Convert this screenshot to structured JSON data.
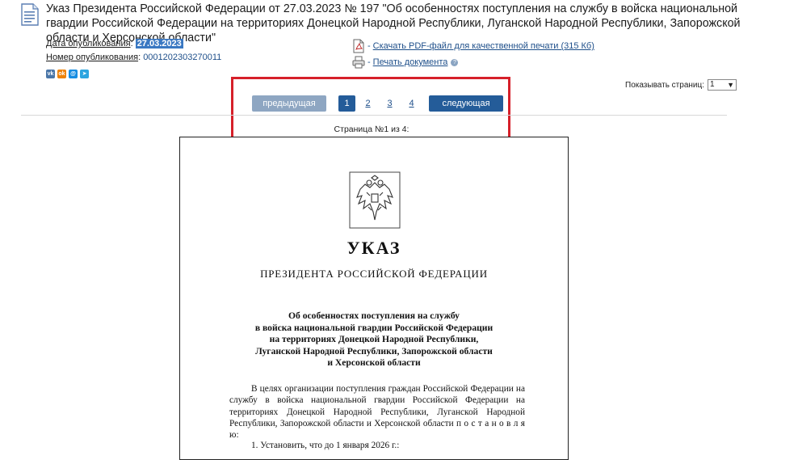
{
  "document": {
    "title": "Указ Президента Российской Федерации от 27.03.2023 № 197 \"Об особенностях поступления на службу в войска национальной гвардии Российской Федерации на территориях Донецкой Народной Республики, Луганской Народной Республики, Запорожской области и Херсонской области\"",
    "icon": "document-icon"
  },
  "meta": {
    "pub_date_label": "Дата опубликования",
    "pub_date_value": "27.03.2023",
    "pub_number_label": "Номер опубликования",
    "pub_number_value": "0001202303270011"
  },
  "social": [
    {
      "name": "vk-icon",
      "glyph": "vk",
      "color": "#4a76a8"
    },
    {
      "name": "odnoklassniki-icon",
      "glyph": "ok",
      "color": "#ee8208"
    },
    {
      "name": "mailru-icon",
      "glyph": "@",
      "color": "#168de2"
    },
    {
      "name": "telegram-icon",
      "glyph": "➤",
      "color": "#2ca5e0"
    }
  ],
  "links": {
    "pdf_label": "Скачать PDF-файл для качественной печати (315 Кб)",
    "print_label": "Печать документа",
    "dash": "-",
    "help_glyph": "?"
  },
  "pages_select": {
    "label": "Показывать страниц:",
    "value": "1"
  },
  "pager": {
    "prev_label": "предыдущая",
    "next_label": "следующая",
    "pages": [
      "1",
      "2",
      "3",
      "4"
    ],
    "current": "1",
    "status": "Страница №1 из 4:"
  },
  "paper": {
    "heading": "УКАЗ",
    "subheading": "ПРЕЗИДЕНТА РОССИЙСКОЙ ФЕДЕРАЦИИ",
    "subject_lines": [
      "Об особенностях поступления на службу",
      "в войска национальной гвардии Российской Федерации",
      "на территориях Донецкой Народной Республики,",
      "Луганской Народной Республики, Запорожской области",
      "и Херсонской области"
    ],
    "body": "В целях организации поступления граждан Российской Федерации на службу в войска национальной гвардии Российской Федерации на территориях Донецкой Народной Республики, Луганской Народной Республики, Запорожской области и Херсонской области п о с т а н о в л я ю:",
    "item1": "1. Установить, что до 1 января 2026 г.:"
  },
  "colors": {
    "accent": "#245c99",
    "highlight": "#d6202a",
    "link": "#1e4f8a"
  }
}
